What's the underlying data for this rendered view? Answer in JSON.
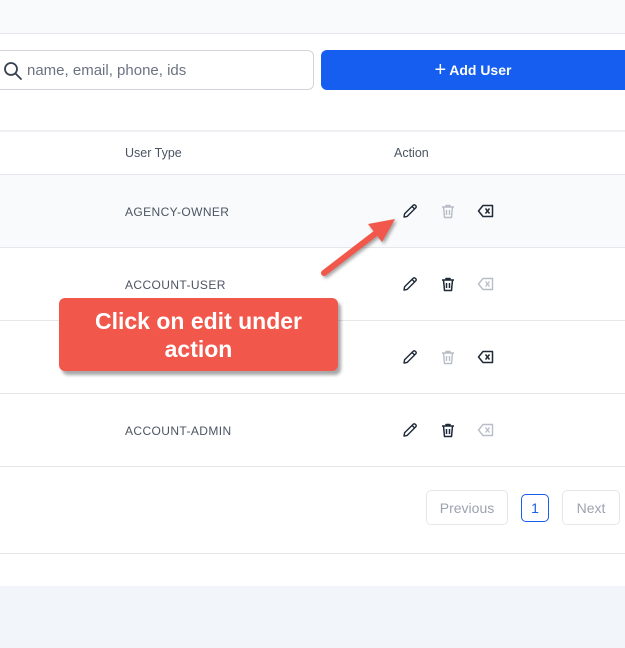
{
  "search": {
    "placeholder": "name, email, phone, ids",
    "icon": "search-icon"
  },
  "toolbar": {
    "add_user_label": "Add User",
    "add_user_icon": "plus-icon",
    "accent": "#155eef"
  },
  "table": {
    "columns": {
      "user_type": "User Type",
      "action": "Action"
    },
    "rows": [
      {
        "user_type": "AGENCY-OWNER",
        "edit": "enabled",
        "delete": "disabled",
        "remove": "enabled"
      },
      {
        "user_type": "ACCOUNT-USER",
        "edit": "enabled",
        "delete": "enabled",
        "remove": "disabled"
      },
      {
        "user_type": "",
        "edit": "enabled",
        "delete": "disabled",
        "remove": "enabled"
      },
      {
        "user_type": "ACCOUNT-ADMIN",
        "edit": "enabled",
        "delete": "enabled",
        "remove": "disabled"
      }
    ]
  },
  "pagination": {
    "previous": "Previous",
    "current_page": "1",
    "next": "Next"
  },
  "annotation": {
    "text_line1": "Click on edit under",
    "text_line2": "action",
    "color": "#f2574b"
  }
}
